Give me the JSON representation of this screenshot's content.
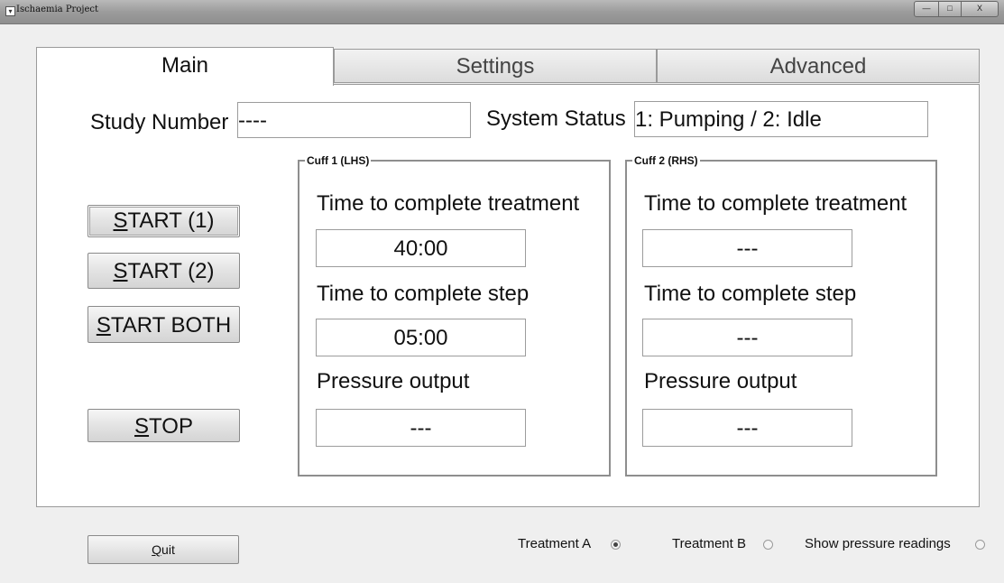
{
  "window": {
    "title": "Ischaemia Project",
    "minimize": "—",
    "maximize": "□",
    "close": "X"
  },
  "tabs": [
    {
      "label": "Main",
      "active": true
    },
    {
      "label": "Settings",
      "active": false
    },
    {
      "label": "Advanced",
      "active": false
    }
  ],
  "main": {
    "study_number_label": "Study Number",
    "study_number_value": "----",
    "system_status_label": "System Status",
    "system_status_value": "1: Pumping / 2: Idle",
    "buttons": {
      "start1": {
        "accel": "S",
        "rest": "TART (1)"
      },
      "start2": {
        "accel": "S",
        "rest": "TART (2)"
      },
      "start_both": {
        "accel": "S",
        "rest": "TART BOTH"
      },
      "stop": {
        "accel": "S",
        "rest": "TOP"
      }
    },
    "cuff1": {
      "legend": "Cuff 1 (LHS)",
      "treatment_label": "Time to complete treatment",
      "treatment_value": "40:00",
      "step_label": "Time to complete step",
      "step_value": "05:00",
      "pressure_label": "Pressure output",
      "pressure_value": "---"
    },
    "cuff2": {
      "legend": "Cuff 2 (RHS)",
      "treatment_label": "Time to complete treatment",
      "treatment_value": "---",
      "step_label": "Time to complete step",
      "step_value": "---",
      "pressure_label": "Pressure output",
      "pressure_value": "---"
    }
  },
  "footer": {
    "quit": {
      "accel": "Q",
      "rest": "uit"
    },
    "radios": [
      {
        "label": "Treatment A",
        "checked": true
      },
      {
        "label": "Treatment B",
        "checked": false
      },
      {
        "label": "Show pressure readings",
        "checked": false
      }
    ]
  }
}
